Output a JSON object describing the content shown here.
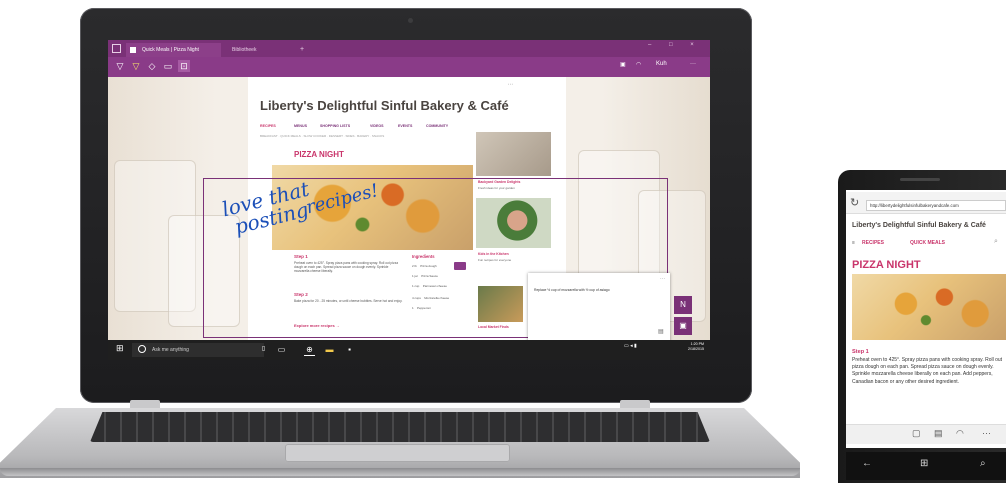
{
  "browser": {
    "tab_active_label": "Quick Meals | Pizza Night",
    "tab_inactive_label": "Bibliotheek",
    "tab_new": "+",
    "window_controls": "– □ ×",
    "toolbar_right": "Kuh"
  },
  "website": {
    "title": "Liberty's Delightful Sinful Bakery & Café",
    "nav": [
      "RECIPES",
      "MENUS",
      "SHOPPING LISTS",
      "VIDEOS",
      "EVENTS",
      "COMMUNITY"
    ],
    "subnav": "BREAKFAST · QUICK MEALS · SLOW COOKER · DESSERT · SIDES · BAKERY · SNACKS",
    "pizza_title": "PIZZA NIGHT",
    "step1_heading": "Step 1",
    "step1_text": "Preheat oven to 425°. Spray pizza pans with cooking spray. Roll out pizza dough on each pan. Spread pizza sauce on dough evenly. Sprinkle mozzarella cheese liberally.",
    "step2_heading": "Step 2",
    "step2_text": "Bake pizza for 20 - 25 minutes, or until cheese bubbles. Serve hot and enjoy.",
    "explore_link": "Explore more recipes →",
    "ingredients_heading": "Ingredients",
    "ingredients": [
      {
        "qty": "2 lb",
        "item": "Pizza dough"
      },
      {
        "qty": "1 jar",
        "item": "Pizza Sauce"
      },
      {
        "qty": "1 cup",
        "item": "Parmesan cheese"
      },
      {
        "qty": "4 cups",
        "item": "Mozzarella cheese"
      },
      {
        "qty": "1",
        "item": "Pepperoni"
      }
    ],
    "sidebar_link1": "Backyard Garden Delights",
    "sidebar_text1": "Fresh ideas for your garden",
    "sidebar_link2": "Kids in the Kitchen",
    "sidebar_text2": "Fun recipes for everyone",
    "sidebar_link3": "Local Market Finds"
  },
  "inking": {
    "handwriting_line1": "love that",
    "handwriting_line2": "posting",
    "handwriting_line3": "recipes!",
    "comment_text": "Replace ½ cup of mozzarella with ½ cup of asiago"
  },
  "taskbar": {
    "search_placeholder": "Ask me anything",
    "clock_time": "1:20 PM",
    "clock_date": "2/18/2015"
  },
  "phone": {
    "url": "http://libertydelightfulsinfulbakeryandcafe.com",
    "title": "Liberty's Delightful Sinful Bakery & Café",
    "nav_recipes": "RECIPES",
    "nav_quick_meals": "QUICK MEALS",
    "pizza_title": "PIZZA NIGHT",
    "step_heading": "Step 1",
    "step_text": "Preheat oven to 425°. Spray pizza pans with cooking spray. Roll out pizza dough on each pan. Spread pizza sauce on dough evenly. Sprinkle mozzarella cheese liberally on each pan. Add peppers, Canadian bacon or any other desired ingredient."
  },
  "colors": {
    "edge_purple": "#7a3177",
    "accent_pink": "#c9356b",
    "ink_blue": "#1b4fb8"
  }
}
